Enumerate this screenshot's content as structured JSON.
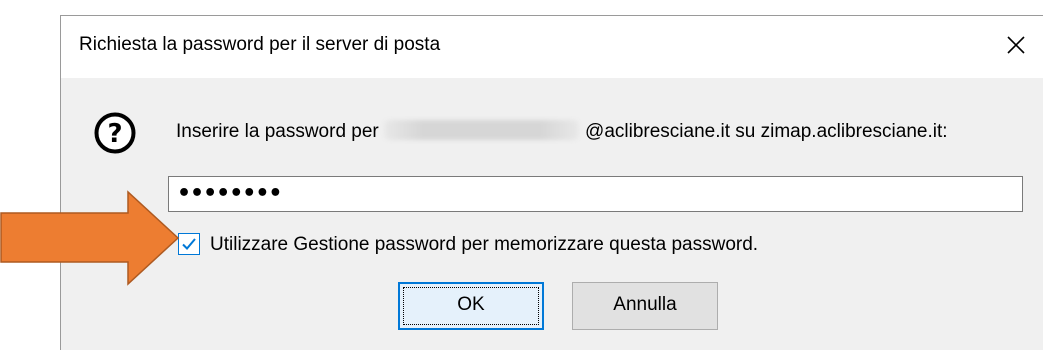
{
  "dialog": {
    "title": "Richiesta la password per il server di posta",
    "close_icon": "close-icon",
    "info_icon": "question-circle-icon",
    "prompt_prefix": "Inserire la password per",
    "prompt_suffix": "@aclibresciane.it su zimap.aclibresciane.it:",
    "password_value": "••••••••",
    "remember_checked": true,
    "remember_label": "Utilizzare Gestione password per memorizzare questa password.",
    "ok_label": "OK",
    "cancel_label": "Annulla"
  },
  "annotation": {
    "arrow_color": "#ed7d31",
    "arrow_border_color": "#ae5a21"
  },
  "colors": {
    "accent": "#0078d7",
    "dialog_bg": "#f0f0f0"
  }
}
